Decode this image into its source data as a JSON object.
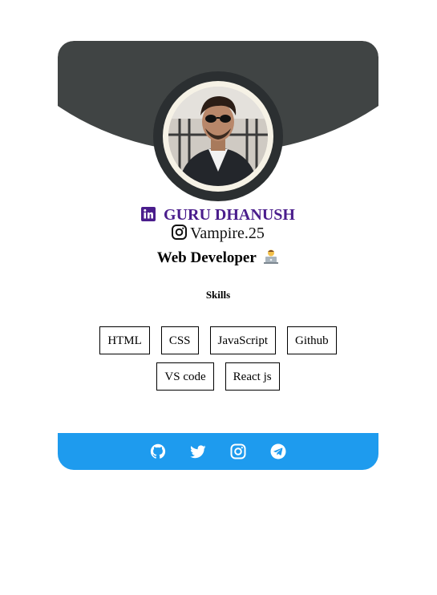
{
  "profile": {
    "name": "GURU DHANUSH",
    "instagram_handle": "Vampire.25",
    "role": "Web Developer"
  },
  "skills_title": "Skills",
  "skills": [
    "HTML",
    "CSS",
    "JavaScript",
    "Github",
    "VS code",
    "React js"
  ],
  "footer_icons": [
    "github-icon",
    "twitter-icon",
    "instagram-icon",
    "telegram-icon"
  ],
  "colors": {
    "header_bg": "#404444",
    "name_color": "#4a1d8c",
    "footer_bg": "#1e9bee"
  }
}
